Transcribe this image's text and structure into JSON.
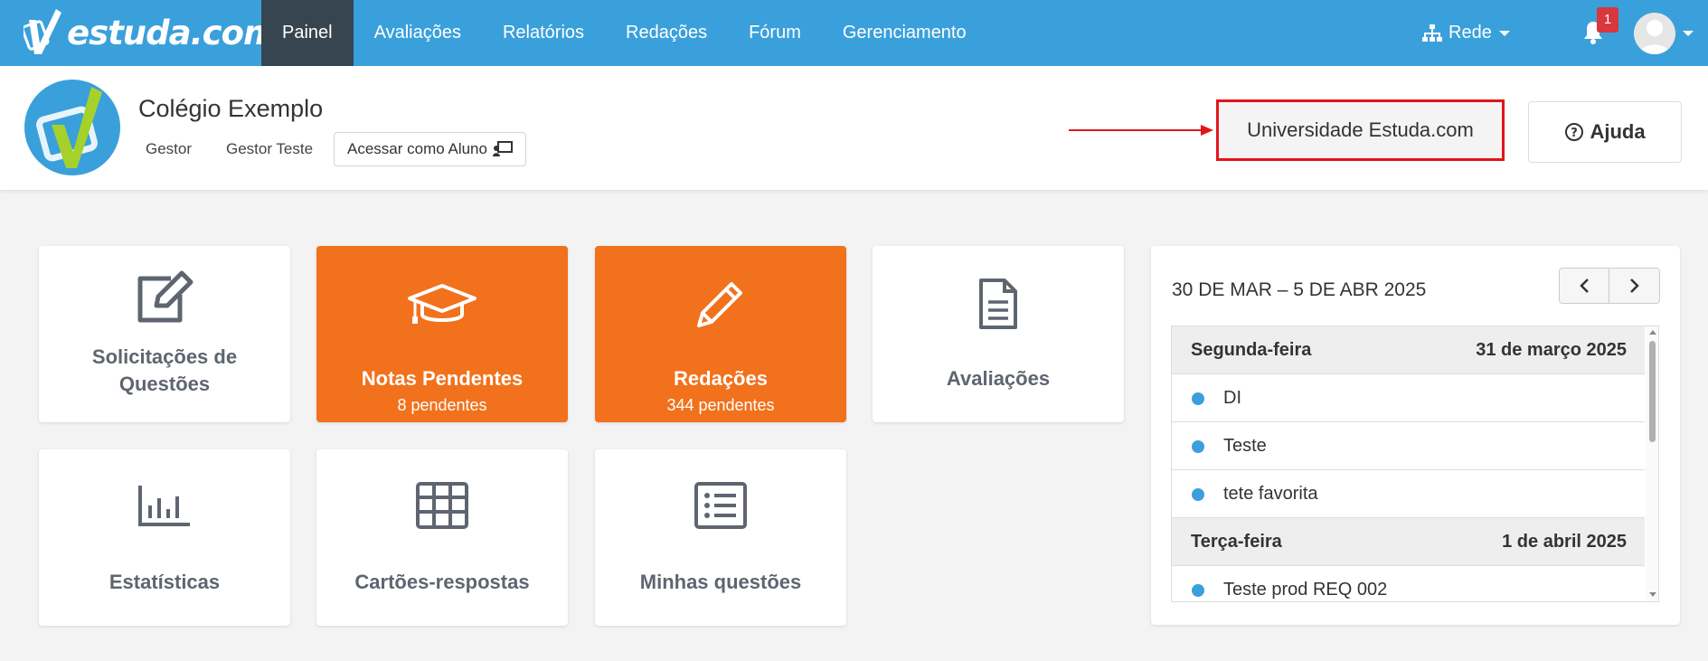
{
  "nav": {
    "logo_text": "estuda.com",
    "items": [
      {
        "label": "Painel",
        "active": true
      },
      {
        "label": "Avaliações"
      },
      {
        "label": "Relatórios"
      },
      {
        "label": "Redações"
      },
      {
        "label": "Fórum"
      },
      {
        "label": "Gerenciamento"
      }
    ],
    "rede_label": "Rede",
    "notification_count": "1",
    "colors": {
      "bar": "#3aa0db",
      "active": "#36454f",
      "badge": "#d9363e"
    }
  },
  "school": {
    "name": "Colégio Exemplo",
    "role": "Gestor",
    "user": "Gestor Teste",
    "student_access_label": "Acessar como Aluno",
    "university_button": "Universidade Estuda.com",
    "help_button": "Ajuda",
    "highlight_color": "#e3151a"
  },
  "cards": [
    {
      "title_line1": "Solicitações de",
      "title_line2": "Questões",
      "icon": "edit-icon"
    },
    {
      "title": "Notas Pendentes",
      "subtitle": "8 pendentes",
      "icon": "graduation-cap-icon",
      "color": "#f2711c"
    },
    {
      "title": "Redações",
      "subtitle": "344 pendentes",
      "icon": "pencil-icon",
      "color": "#f2711c"
    },
    {
      "title": "Avaliações",
      "icon": "document-icon"
    },
    {
      "title": "Estatísticas",
      "icon": "bar-chart-icon"
    },
    {
      "title": "Cartões-respostas",
      "icon": "grid-icon"
    },
    {
      "title": "Minhas questões",
      "icon": "list-icon"
    }
  ],
  "calendar": {
    "range_title": "30 DE MAR – 5 DE ABR 2025",
    "days": [
      {
        "weekday": "Segunda-feira",
        "date": "31 de março 2025",
        "events": [
          "DI",
          "Teste",
          "tete favorita"
        ]
      },
      {
        "weekday": "Terça-feira",
        "date": "1 de abril 2025",
        "events": [
          "Teste prod REQ 002"
        ]
      }
    ],
    "event_dot_color": "#3aa0db"
  }
}
